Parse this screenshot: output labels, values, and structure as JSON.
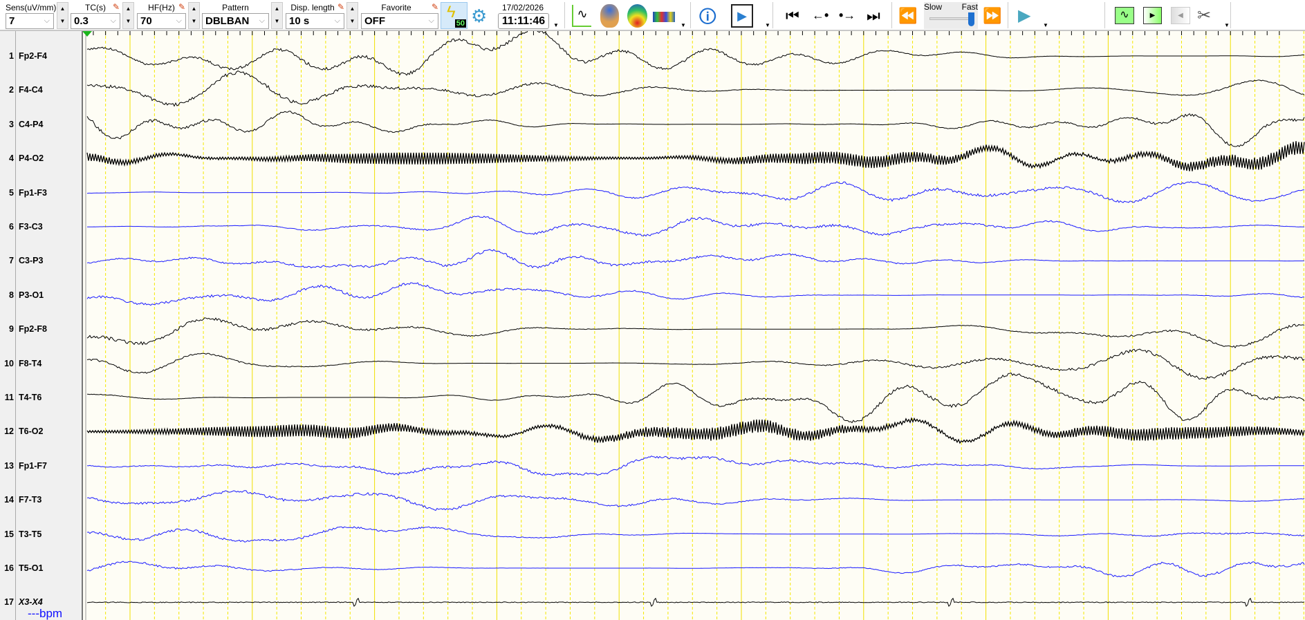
{
  "toolbar": {
    "sens": {
      "label": "Sens(uV/mm)",
      "value": "7"
    },
    "tc": {
      "label": "TC(s)",
      "value": "0.3"
    },
    "hf": {
      "label": "HF(Hz)",
      "value": "70"
    },
    "pattern": {
      "label": "Pattern",
      "value": "DBLBAN"
    },
    "disp_length": {
      "label": "Disp. length",
      "value": "10 s"
    },
    "favorite": {
      "label": "Favorite",
      "value": "OFF"
    },
    "notch_badge": "50",
    "date": "17/02/2026",
    "time": "11:11:46",
    "speed": {
      "slow_label": "Slow",
      "fast_label": "Fast",
      "value": 1.0
    }
  },
  "channels": [
    {
      "n": "1",
      "name": "Fp2-F4",
      "color": "#000000"
    },
    {
      "n": "2",
      "name": "F4-C4",
      "color": "#000000"
    },
    {
      "n": "3",
      "name": "C4-P4",
      "color": "#000000"
    },
    {
      "n": "4",
      "name": "P4-O2",
      "color": "#000000"
    },
    {
      "n": "5",
      "name": "Fp1-F3",
      "color": "#1a1aff"
    },
    {
      "n": "6",
      "name": "F3-C3",
      "color": "#1a1aff"
    },
    {
      "n": "7",
      "name": "C3-P3",
      "color": "#1a1aff"
    },
    {
      "n": "8",
      "name": "P3-O1",
      "color": "#1a1aff"
    },
    {
      "n": "9",
      "name": "Fp2-F8",
      "color": "#000000"
    },
    {
      "n": "10",
      "name": "F8-T4",
      "color": "#000000"
    },
    {
      "n": "11",
      "name": "T4-T6",
      "color": "#000000"
    },
    {
      "n": "12",
      "name": "T6-O2",
      "color": "#000000"
    },
    {
      "n": "13",
      "name": "Fp1-F7",
      "color": "#1a1aff"
    },
    {
      "n": "14",
      "name": "F7-T3",
      "color": "#1a1aff"
    },
    {
      "n": "15",
      "name": "T3-T5",
      "color": "#1a1aff"
    },
    {
      "n": "16",
      "name": "T5-O1",
      "color": "#1a1aff"
    },
    {
      "n": "17",
      "name": "X3-X4",
      "color": "#000000"
    }
  ],
  "heart_rate": "---bpm"
}
